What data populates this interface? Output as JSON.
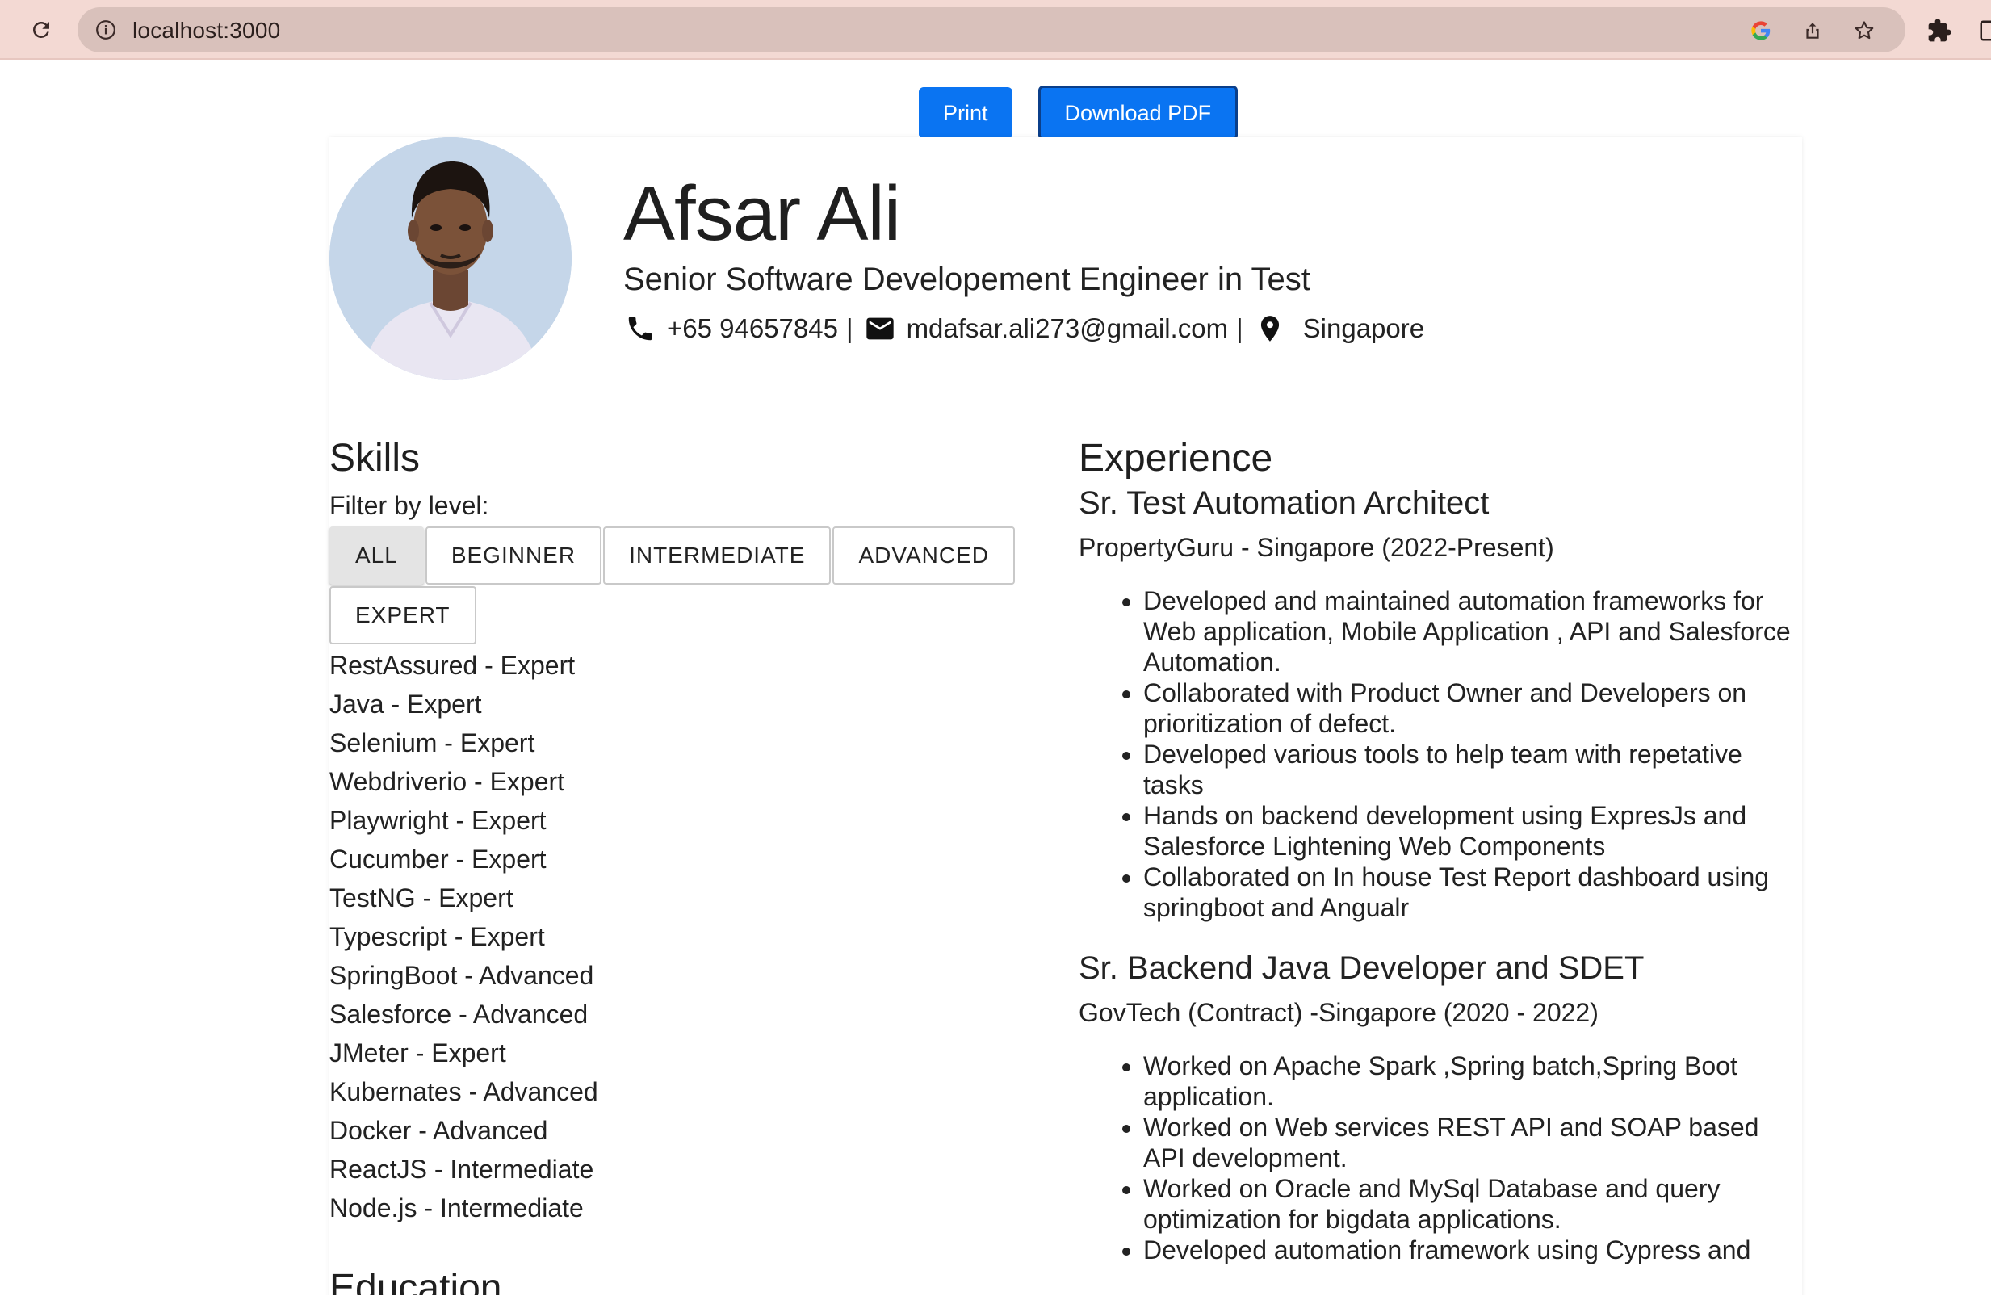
{
  "browser": {
    "url": "localhost:3000"
  },
  "actions": {
    "print_label": "Print",
    "download_label": "Download PDF"
  },
  "profile": {
    "name": "Afsar Ali",
    "title": "Senior Software Developement Engineer in Test",
    "phone": "+65 94657845",
    "email": "mdafsar.ali273@gmail.com",
    "location": "Singapore",
    "separator": "|"
  },
  "skills": {
    "title": "Skills",
    "filter_label": "Filter by level:",
    "filters": [
      "ALL",
      "BEGINNER",
      "INTERMEDIATE",
      "ADVANCED",
      "EXPERT"
    ],
    "active_filter": "ALL",
    "items": [
      "RestAssured - Expert",
      "Java - Expert",
      "Selenium - Expert",
      "Webdriverio - Expert",
      "Playwright - Expert",
      "Cucumber - Expert",
      "TestNG - Expert",
      "Typescript - Expert",
      "SpringBoot - Advanced",
      "Salesforce - Advanced",
      "JMeter - Expert",
      "Kubernates - Advanced",
      "Docker - Advanced",
      "ReactJS - Intermediate",
      "Node.js - Intermediate"
    ]
  },
  "education": {
    "title": "Education"
  },
  "experience": {
    "title": "Experience",
    "jobs": [
      {
        "role": "Sr. Test Automation Architect",
        "company": "PropertyGuru - Singapore (2022-Present)",
        "bullets": [
          "Developed and maintained automation frameworks for Web application, Mobile Application , API and Salesforce Automation.",
          "Collaborated with Product Owner and Developers on prioritization of defect.",
          "Developed various tools to help team with repetative tasks",
          "Hands on backend development using ExpresJs and Salesforce Lightening Web Components",
          "Collaborated on In house Test Report dashboard using springboot and Angualr"
        ]
      },
      {
        "role": "Sr. Backend Java Developer and SDET",
        "company": "GovTech (Contract) -Singapore (2020 - 2022)",
        "bullets": [
          "Worked on Apache Spark ,Spring batch,Spring Boot application.",
          "Worked on Web services REST API and SOAP based API development.",
          "Worked on Oracle and MySql Database and query optimization for bigdata applications.",
          "Developed automation framework using Cypress and"
        ]
      }
    ]
  }
}
